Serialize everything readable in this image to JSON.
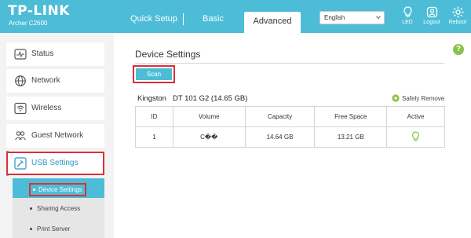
{
  "header": {
    "brand": "TP-LINK",
    "model": "Archer C2600",
    "tabs": [
      "Quick Setup",
      "Basic",
      "Advanced"
    ],
    "language": "English",
    "buttons": {
      "led": "LED",
      "logout": "Logout",
      "reboot": "Reboot"
    },
    "accent": "#4dbdd7"
  },
  "sidebar": {
    "items": [
      {
        "label": "Status",
        "icon": "status-icon"
      },
      {
        "label": "Network",
        "icon": "globe-icon"
      },
      {
        "label": "Wireless",
        "icon": "wireless-icon"
      },
      {
        "label": "Guest Network",
        "icon": "guest-icon"
      },
      {
        "label": "USB Settings",
        "icon": "usb-icon"
      }
    ],
    "submenu": [
      "Device Settings",
      "Sharing Access",
      "Print Server"
    ]
  },
  "main": {
    "help": "?",
    "title": "Device Settings",
    "scan_label": "Scan",
    "drive": {
      "vendor": "Kingston",
      "model": "DT 101 G2 (14.65 GB)"
    },
    "safely_remove": "Safely Remove",
    "table": {
      "headers": [
        "ID",
        "Volume",
        "Capacity",
        "Free Space",
        "Active"
      ],
      "rows": [
        {
          "id": "1",
          "volume": "C��",
          "capacity": "14.64 GB",
          "free": "13.21 GB",
          "active_icon": "bulb-icon"
        }
      ]
    },
    "highlight_color": "#d9313a"
  }
}
